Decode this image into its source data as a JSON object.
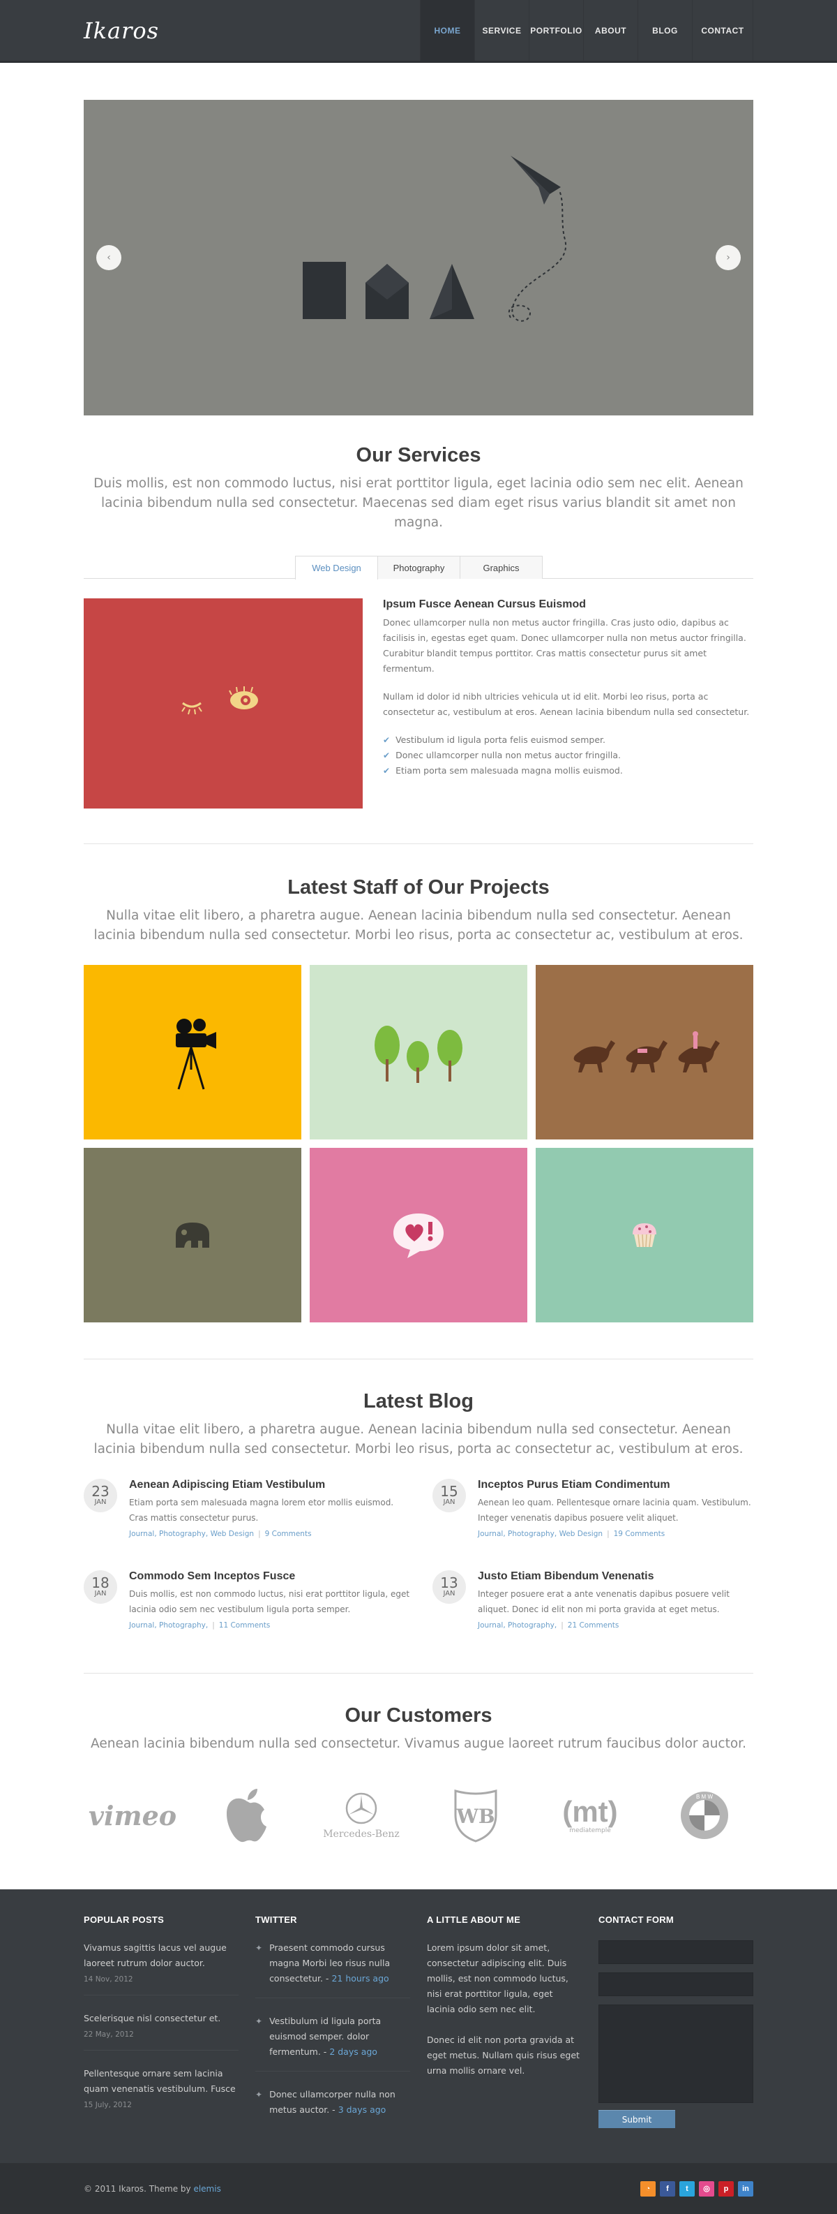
{
  "header": {
    "logo": "Ikaros",
    "nav": [
      "HOME",
      "SERVICE",
      "PORTFOLIO",
      "ABOUT",
      "BLOG",
      "CONTACT"
    ],
    "active": "HOME"
  },
  "slider": {
    "prev_icon": "chevron-left-icon",
    "next_icon": "chevron-right-icon",
    "prev_glyph": "‹",
    "next_glyph": "›"
  },
  "services": {
    "title": "Our Services",
    "intro": "Duis mollis, est non commodo luctus, nisi erat porttitor ligula, eget lacinia odio sem nec elit. Aenean lacinia bibendum nulla sed consectetur. Maecenas sed diam eget risus varius blandit sit amet non magna.",
    "tabs": [
      "Web Design",
      "Photography",
      "Graphics"
    ],
    "active_tab": "Web Design",
    "content": {
      "heading": "Ipsum Fusce Aenean Cursus Euismod",
      "p1": "Donec ullamcorper nulla non metus auctor fringilla. Cras justo odio, dapibus ac facilisis in, egestas eget quam. Donec ullamcorper nulla non metus auctor fringilla. Curabitur blandit tempus porttitor. Cras mattis consectetur purus sit amet fermentum.",
      "p2": "Nullam id dolor id nibh ultricies vehicula ut id elit. Morbi leo risus, porta ac consectetur ac, vestibulum at eros. Aenean lacinia bibendum nulla sed consectetur.",
      "checks": [
        "Vestibulum id ligula porta felis euismod semper.",
        "Donec ullamcorper nulla non metus auctor fringilla.",
        "Etiam porta sem malesuada magna mollis euismod."
      ]
    }
  },
  "projects": {
    "title": "Latest Staff of Our Projects",
    "intro": "Nulla vitae elit libero, a pharetra augue. Aenean lacinia bibendum nulla sed consectetur. Aenean lacinia bibendum nulla sed consectetur. Morbi leo risus, porta ac consectetur ac, vestibulum at eros.",
    "tiles": [
      {
        "color": "#fbb800",
        "icon": "movie-camera-icon"
      },
      {
        "color": "#cfe6cc",
        "icon": "trees-icon"
      },
      {
        "color": "#9c6f48",
        "icon": "horses-icon"
      },
      {
        "color": "#7b7a5f",
        "icon": "elephant-icon"
      },
      {
        "color": "#e17ba2",
        "icon": "heart-speech-bubble-icon"
      },
      {
        "color": "#92cab0",
        "icon": "cupcake-icon"
      }
    ]
  },
  "blog": {
    "title": "Latest Blog",
    "intro": "Nulla vitae elit libero, a pharetra augue. Aenean lacinia bibendum nulla sed consectetur. Aenean lacinia bibendum nulla sed consectetur. Morbi leo risus, porta ac consectetur ac, vestibulum at eros.",
    "posts": [
      {
        "day": "23",
        "month": "JAN",
        "title": "Aenean Adipiscing Etiam Vestibulum",
        "excerpt": "Etiam porta sem malesuada magna lorem etor mollis euismod. Cras mattis consectetur purus.",
        "cats": "Journal, Photography, Web Design",
        "comments": "9 Comments"
      },
      {
        "day": "15",
        "month": "JAN",
        "title": "Inceptos Purus Etiam Condimentum",
        "excerpt": "Aenean leo quam. Pellentesque ornare lacinia quam. Vestibulum. Integer venenatis dapibus posuere velit aliquet.",
        "cats": "Journal, Photography, Web Design",
        "comments": "19 Comments"
      },
      {
        "day": "18",
        "month": "JAN",
        "title": "Commodo Sem Inceptos Fusce",
        "excerpt": "Duis mollis, est non commodo luctus, nisi erat porttitor ligula, eget lacinia odio sem nec vestibulum ligula porta semper.",
        "cats": "Journal, Photography,",
        "comments": "11 Comments"
      },
      {
        "day": "13",
        "month": "JAN",
        "title": "Justo Etiam Bibendum Venenatis",
        "excerpt": "Integer posuere erat a ante venenatis dapibus posuere velit aliquet. Donec id elit non mi porta gravida at eget metus.",
        "cats": "Journal, Photography,",
        "comments": "21 Comments"
      }
    ]
  },
  "customers": {
    "title": "Our Customers",
    "intro": "Aenean lacinia bibendum nulla sed consectetur. Vivamus augue laoreet rutrum faucibus dolor auctor.",
    "logos": [
      "vimeo",
      "apple",
      "Mercedes-Benz",
      "WB",
      "(mt)",
      "BMW"
    ],
    "logo_texts": {
      "vimeo": "vimeo",
      "mercedes": "Mercedes-Benz",
      "wb": "WB",
      "mt": "(mt)",
      "mt_sub": "mediatemple",
      "bmw": "B M W"
    }
  },
  "footer": {
    "popular": {
      "title": "POPULAR POSTS",
      "items": [
        {
          "text": "Vivamus sagittis lacus vel augue laoreet rutrum dolor auctor.",
          "date": "14 Nov, 2012"
        },
        {
          "text": "Scelerisque nisl consectetur et.",
          "date": "22 May, 2012"
        },
        {
          "text": "Pellentesque ornare sem lacinia quam venenatis vestibulum. Fusce",
          "date": "15 July, 2012"
        }
      ]
    },
    "twitter": {
      "title": "TWITTER",
      "items": [
        {
          "text": "Praesent commodo cursus magna Morbi leo risus nulla consectetur. -",
          "ago": "21 hours ago"
        },
        {
          "text": "Vestibulum id ligula porta euismod semper. dolor fermentum. -",
          "ago": "2 days ago"
        },
        {
          "text": "Donec ullamcorper nulla non metus auctor. -",
          "ago": "3 days ago"
        }
      ]
    },
    "about": {
      "title": "A LITTLE ABOUT ME",
      "p1": "Lorem ipsum dolor sit amet, consectetur adipiscing elit. Duis mollis, est non commodo luctus, nisi erat porttitor ligula, eget lacinia odio sem nec elit.",
      "p2": "Donec id elit non porta gravida at eget metus. Nullam quis risus eget urna mollis ornare vel."
    },
    "contact": {
      "title": "CONTACT FORM",
      "submit": "Submit"
    },
    "copyright": "© 2011 Ikaros. Theme by",
    "credit": "elemis",
    "socials": [
      {
        "name": "rss-icon",
        "glyph": "◔",
        "color": "#f58f2b"
      },
      {
        "name": "facebook-icon",
        "glyph": "f",
        "color": "#3b5998"
      },
      {
        "name": "twitter-icon",
        "glyph": "t",
        "color": "#2aa4dc"
      },
      {
        "name": "dribbble-icon",
        "glyph": "◎",
        "color": "#e44b8e"
      },
      {
        "name": "pinterest-icon",
        "glyph": "p",
        "color": "#cb2027"
      },
      {
        "name": "linkedin-icon",
        "glyph": "in",
        "color": "#3f83c9"
      }
    ]
  }
}
